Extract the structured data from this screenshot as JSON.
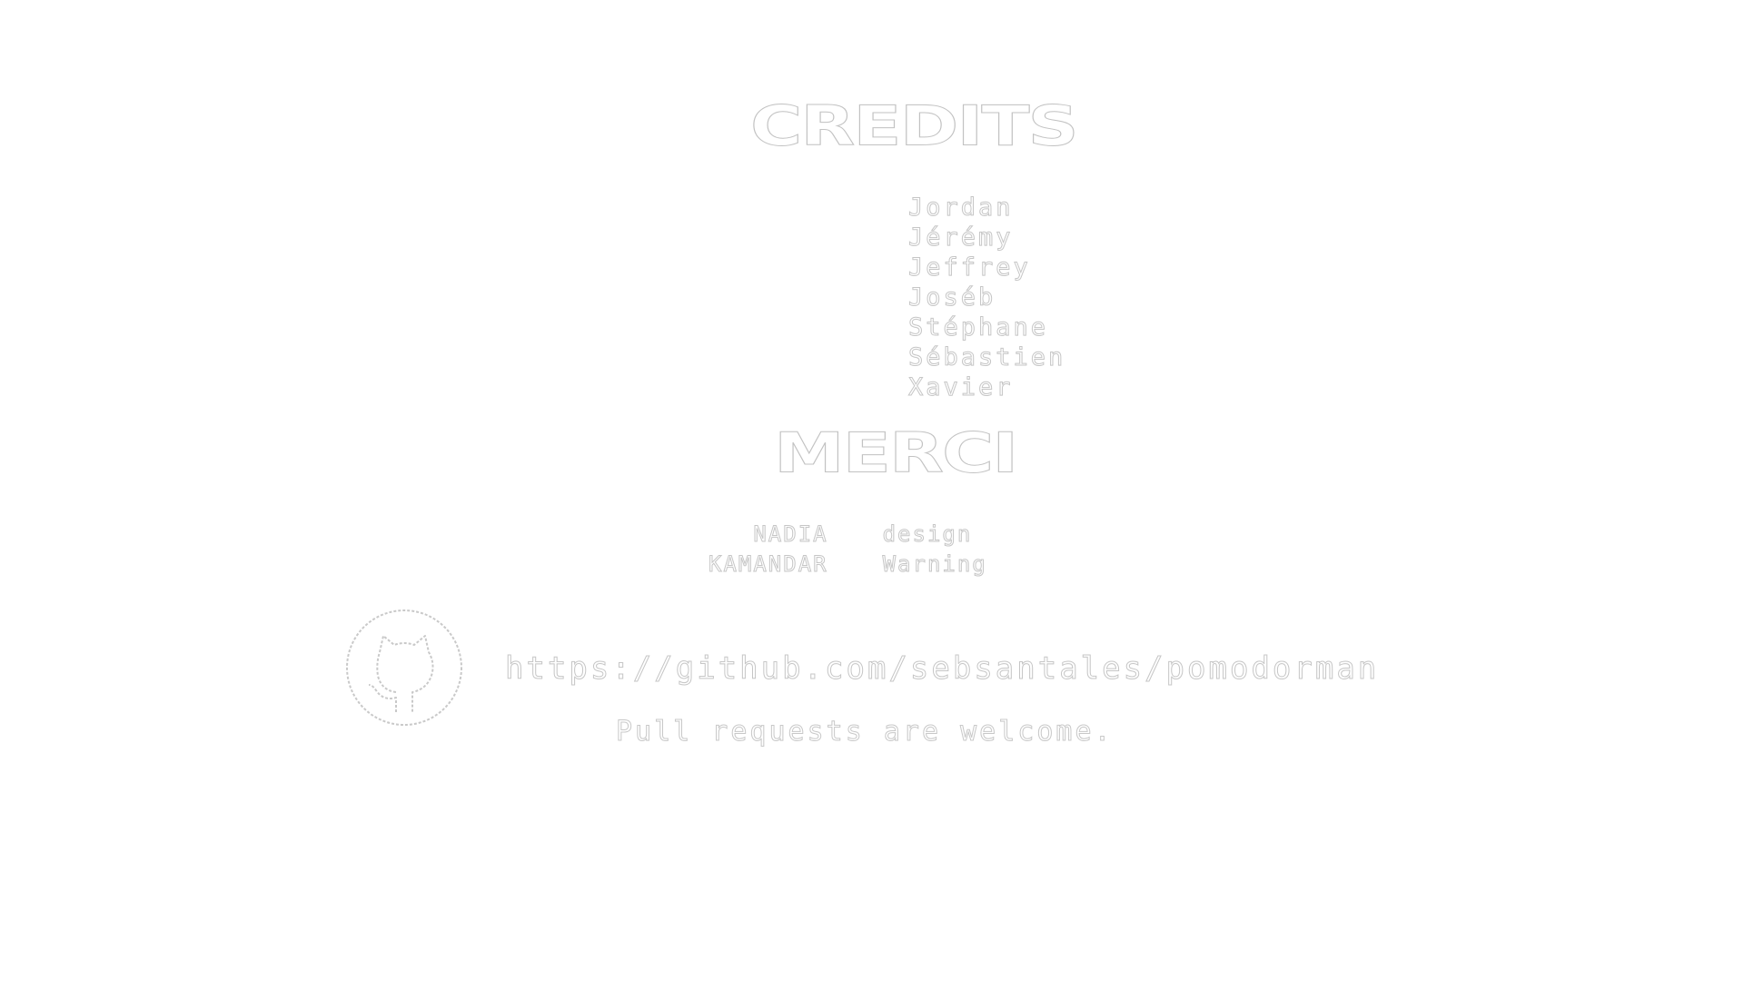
{
  "credits": {
    "heading": "CREDITS",
    "people": [
      "Jordan",
      "Jérémy",
      "Jeffrey",
      "Joséb",
      "Stéphane",
      "Sébastien",
      "Xavier"
    ]
  },
  "thanks": {
    "heading": "MERCI",
    "rows": [
      {
        "who": "NADIA",
        "what": "design"
      },
      {
        "who": "KAMANDAR",
        "what": "Warning"
      }
    ]
  },
  "repo": {
    "icon": "github-icon",
    "url": "https://github.com/sebsantales/pomodorman",
    "note": "Pull requests are welcome."
  },
  "colors": {
    "background": "#ffffff",
    "text_outline": "#c6c6c6"
  }
}
